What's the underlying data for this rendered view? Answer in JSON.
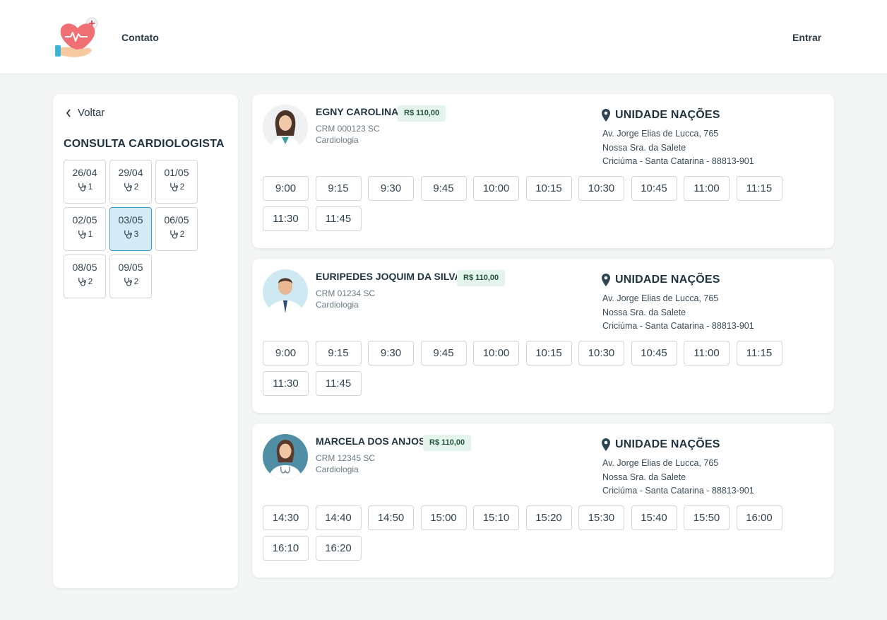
{
  "header": {
    "logo_icon": "heart-in-hand-icon",
    "nav_contact": "Contato",
    "nav_login": "Entrar"
  },
  "sidebar": {
    "back_label": "Voltar",
    "title": "CONSULTA CARDIOLOGISTA",
    "selected_date": "03/05",
    "dates": [
      {
        "date": "26/04",
        "count": "1"
      },
      {
        "date": "29/04",
        "count": "2"
      },
      {
        "date": "01/05",
        "count": "2"
      },
      {
        "date": "02/05",
        "count": "1"
      },
      {
        "date": "03/05",
        "count": "3"
      },
      {
        "date": "06/05",
        "count": "2"
      },
      {
        "date": "08/05",
        "count": "2"
      },
      {
        "date": "09/05",
        "count": "2"
      }
    ]
  },
  "colors": {
    "accent": "#3f97cf",
    "selected_bg": "#d5ebf8",
    "price_bg": "#e4f3ec",
    "price_text": "#22533c"
  },
  "doctors": [
    {
      "name": "EGNY CAROLINA",
      "price": "R$ 110,00",
      "crm": "CRM 000123 SC",
      "specialty": "Cardiologia",
      "unit": "UNIDADE NAÇÕES",
      "address1": "Av. Jorge Elias de Lucca, 765",
      "address2": "Nossa Sra. da Salete",
      "address3": "Criciúma - Santa Catarina - 88813-901",
      "slots": [
        "9:00",
        "9:15",
        "9:30",
        "9:45",
        "10:00",
        "10:15",
        "10:30",
        "10:45",
        "11:00",
        "11:15",
        "11:30",
        "11:45"
      ]
    },
    {
      "name": "EURIPEDES JOQUIM DA SILVA",
      "price": "R$ 110,00",
      "crm": "CRM 01234 SC",
      "specialty": "Cardiologia",
      "unit": "UNIDADE NAÇÕES",
      "address1": "Av. Jorge Elias de Lucca, 765",
      "address2": "Nossa Sra. da Salete",
      "address3": "Criciúma - Santa Catarina - 88813-901",
      "slots": [
        "9:00",
        "9:15",
        "9:30",
        "9:45",
        "10:00",
        "10:15",
        "10:30",
        "10:45",
        "11:00",
        "11:15",
        "11:30",
        "11:45"
      ]
    },
    {
      "name": "MARCELA DOS ANJOS",
      "price": "R$ 110,00",
      "crm": "CRM 12345 SC",
      "specialty": "Cardiologia",
      "unit": "UNIDADE NAÇÕES",
      "address1": "Av. Jorge Elias de Lucca, 765",
      "address2": "Nossa Sra. da Salete",
      "address3": "Criciúma - Santa Catarina - 88813-901",
      "slots": [
        "14:30",
        "14:40",
        "14:50",
        "15:00",
        "15:10",
        "15:20",
        "15:30",
        "15:40",
        "15:50",
        "16:00",
        "16:10",
        "16:20"
      ]
    }
  ]
}
